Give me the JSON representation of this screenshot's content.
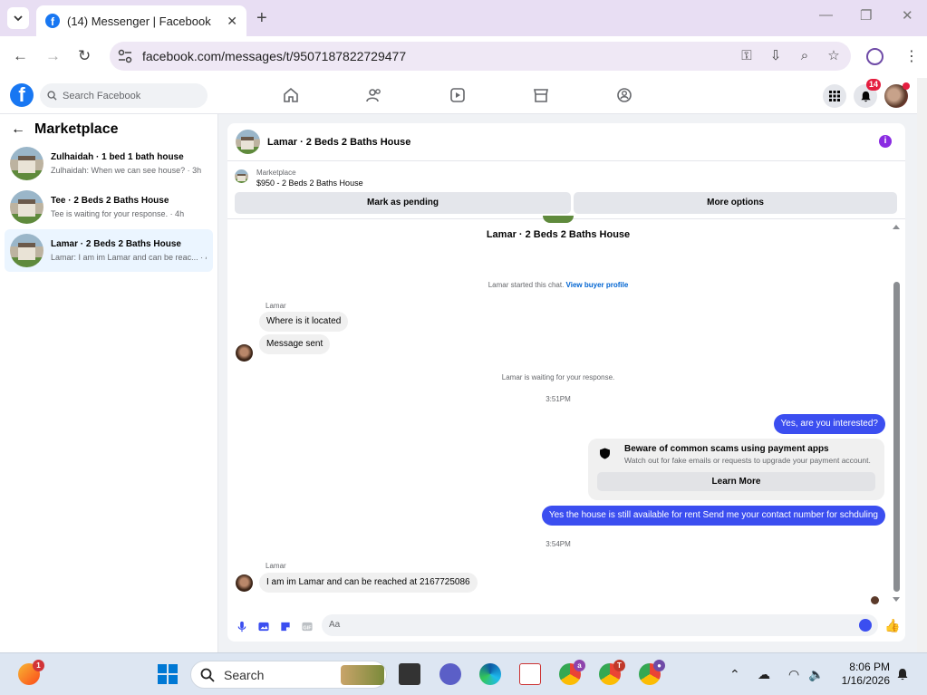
{
  "browser": {
    "tab_title": "(14) Messenger | Facebook",
    "url": "facebook.com/messages/t/9507187822729477"
  },
  "fbnav": {
    "search_placeholder": "Search Facebook",
    "notification_count": "14"
  },
  "leftpane": {
    "title": "Marketplace",
    "threads": [
      {
        "name": "Zulhaidah · 1 bed 1 bath house",
        "preview": "Zulhaidah: When we can see house? · 3h",
        "active": false
      },
      {
        "name": "Tee · 2 Beds 2 Baths House",
        "preview": "Tee is waiting for your response. · 4h",
        "active": false
      },
      {
        "name": "Lamar · 2 Beds 2 Baths House",
        "preview": "Lamar: I am im Lamar and can be reac... · 4h",
        "active": true
      }
    ]
  },
  "chat": {
    "header_name": "Lamar · 2 Beds 2 Baths House",
    "marketplace_label": "Marketplace",
    "listing": "$950 - 2 Beds 2 Baths House",
    "mark_pending": "Mark as pending",
    "more_options": "More options",
    "top_name": "Lamar · 2 Beds 2 Baths House",
    "started_text": "Lamar started this chat.",
    "view_buyer": "View buyer profile",
    "sender_1": "Lamar",
    "msg_in_1": "Where is it located",
    "msg_in_2": "Message sent",
    "waiting": "Lamar is waiting for your response.",
    "time_1": "3:51PM",
    "msg_out_1": "Yes, are you interested?",
    "scam_title": "Beware of common scams using payment apps",
    "scam_desc": "Watch out for fake emails or requests to upgrade your payment account.",
    "learn_more": "Learn More",
    "msg_out_2": "Yes the house is still available for rent Send me your contact number for schduling",
    "time_2": "3:54PM",
    "sender_2": "Lamar",
    "msg_in_3": "I am im Lamar and can be reached at 2167725086",
    "composer_placeholder": "Aa"
  },
  "taskbar": {
    "search_placeholder": "Search",
    "time": "8:06 PM",
    "date": "1/16/2026",
    "weather_badge": "1"
  },
  "colors": {
    "accent": "#3b4ef0",
    "fb_blue": "#1877f2",
    "badge_red": "#e41e3f"
  }
}
